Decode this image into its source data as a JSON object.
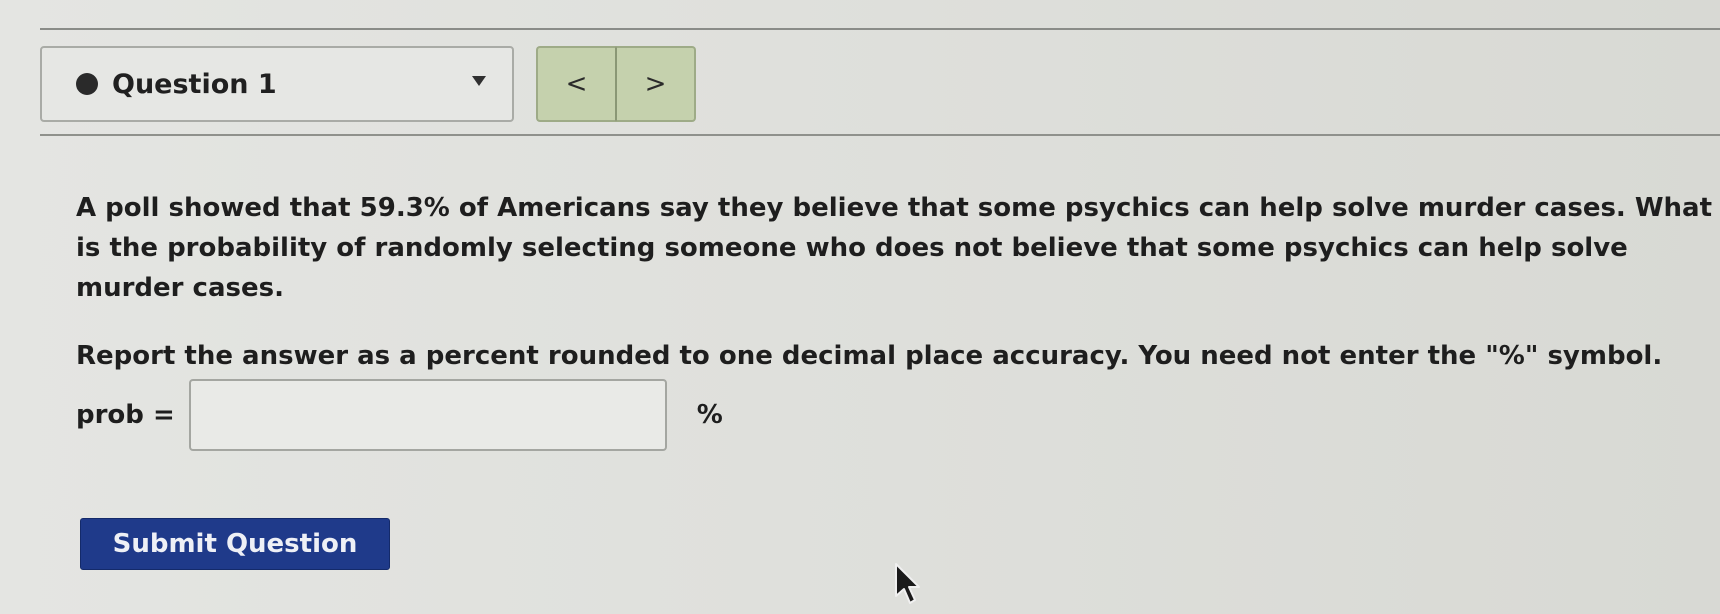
{
  "nav": {
    "question_label": "Question 1",
    "prev_symbol": "<",
    "next_symbol": ">"
  },
  "question": {
    "text": "A poll showed that 59.3% of Americans say they believe that some psychics can help solve murder cases. What is the probability of randomly selecting someone who does not believe that some psychics can help solve murder cases.",
    "instruction": "Report the answer as a percent rounded to one decimal place accuracy. You need not enter the \"%\" symbol."
  },
  "answer": {
    "label": "prob =",
    "value": "",
    "unit": "%"
  },
  "submit": {
    "label": "Submit Question"
  },
  "colors": {
    "submit_bg": "#1f3a8a",
    "pager_bg": "#c5d1ad",
    "page_bg": "#e2e3df"
  },
  "icons": {
    "status": "filled-circle-icon",
    "dropdown": "caret-down-icon",
    "prev": "chevron-left-icon",
    "next": "chevron-right-icon",
    "cursor": "mouse-pointer-icon"
  }
}
